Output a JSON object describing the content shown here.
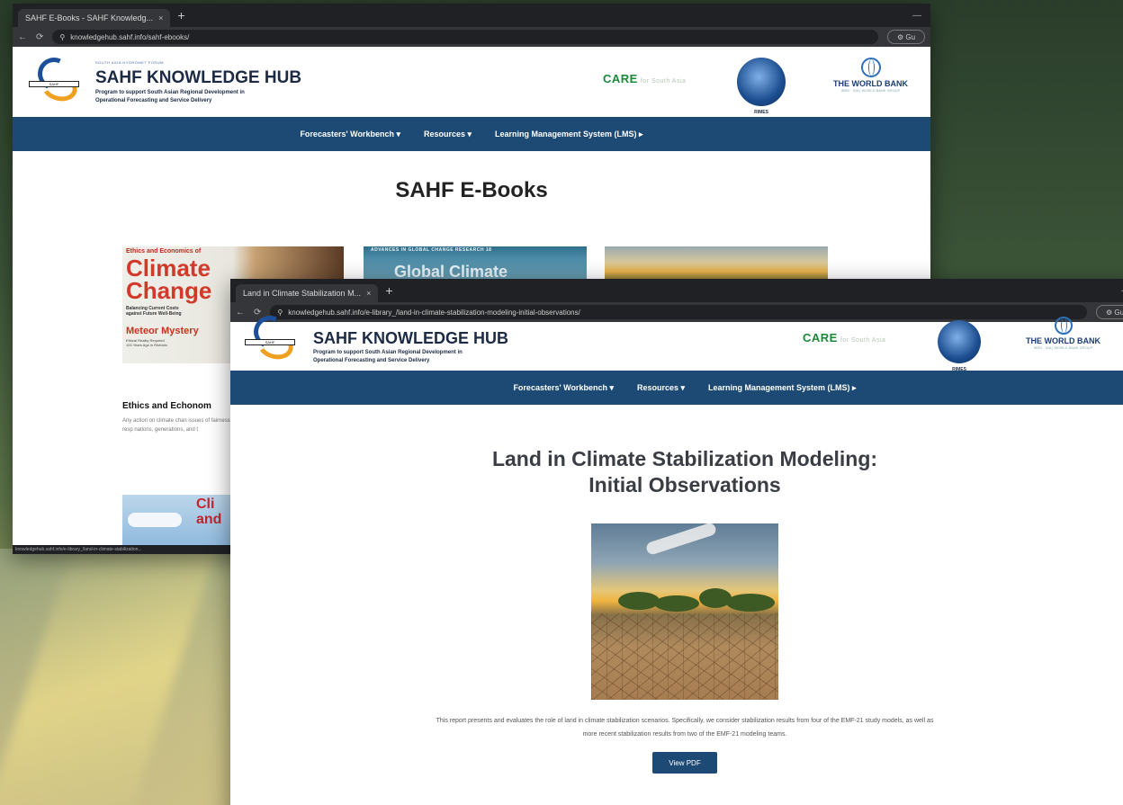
{
  "back_window": {
    "tab_title": "SAHF E-Books - SAHF Knowledg...",
    "url": "knowledgehub.sahf.info/sahf-ebooks/",
    "header": {
      "forum_tag": "SOUTH ASIA HYDROMET FORUM",
      "title": "SAHF KNOWLEDGE HUB",
      "subtitle_line1": "Program to support South Asian Regional Development in",
      "subtitle_line2": "Operational Forecasting and Service Delivery"
    },
    "nav": {
      "item1": "Forecasters' Workbench ▾",
      "item2": "Resources ▾",
      "item3": "Learning Management System (LMS) ▸"
    },
    "page_title": "SAHF E-Books",
    "book1": {
      "cover_top": "Ethics and Economics of",
      "cover_climate": "Climate",
      "cover_change": "Change",
      "cover_sub1": "Balancing Current Costs",
      "cover_sub2": "against Future Well-Being",
      "cover_meteor": "Meteor Mystery",
      "cover_note1": "Ethical Reality Required",
      "cover_note2": "100 Years Ago in Rhetoric",
      "title": "Ethics and Echonom",
      "desc": "Any action on climate chan issues of fairness and resp nations, generations, and t"
    },
    "book2": {
      "series": "ADVANCES IN GLOBAL CHANGE RESEARCH 18",
      "title": "Global Climate"
    },
    "book4": {
      "cover_cl": "Cli",
      "cover_and": "and"
    },
    "status_url": "knowledgehub.sahf.info/e-library_/land-in-climate-stabilization..."
  },
  "front_window": {
    "tab_title": "Land in Climate Stabilization M...",
    "url": "knowledgehub.sahf.info/e-library_/land-in-climate-stabilization-modeling-initial-observations/",
    "header": {
      "title": "SAHF KNOWLEDGE HUB",
      "subtitle_line1": "Program to support South Asian Regional Development in",
      "subtitle_line2": "Operational Forecasting and Service Delivery"
    },
    "nav": {
      "item1": "Forecasters' Workbench ▾",
      "item2": "Resources ▾",
      "item3": "Learning Management System (LMS) ▸"
    },
    "page_title_line1": "Land in Climate Stabilization Modeling:",
    "page_title_line2": "Initial Observations",
    "description": "This report presents and evaluates the role of land in climate stabilization scenarios. Specifically, we consider stabilization results from four of the EMF-21 study models, as well as more recent stabilization results from two of the EMF-21 modeling teams.",
    "view_pdf": "View PDF"
  },
  "logos": {
    "care": "CARE",
    "care_suffix": "for South Asia",
    "rimes": "RIMES",
    "world_bank": "THE WORLD BANK",
    "wb_tag": "IBRD · IDA | WORLD BANK GROUP"
  },
  "chrome": {
    "new_tab": "+",
    "close": "×",
    "reload": "⟳",
    "back": "←",
    "forward": "→",
    "ext": "⚙ Gu"
  },
  "colors": {
    "navbar": "#1d4a75",
    "care_green": "#1a8a3a",
    "title_navy": "#1c2a44"
  }
}
